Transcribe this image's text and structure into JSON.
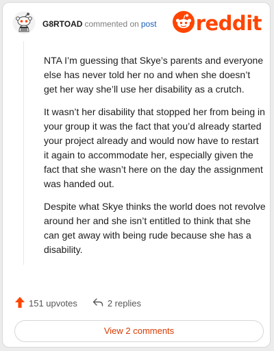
{
  "header": {
    "username": "G8RTOAD",
    "commented_on": "commented on",
    "post_link": "post",
    "logo_text": "reddit"
  },
  "comment": {
    "paragraphs": [
      "NTA I’m guessing that Skye’s parents and everyone else has never told her no and when she doesn’t get her way she’ll use her disability as a crutch.",
      "It wasn’t her disability that stopped her from being in your group it was the fact that you’d already started your project already and would now have to restart it again to accommodate her, especially given the fact that she wasn’t here on the day the assignment was handed out.",
      "Despite what Skye thinks the world does not revolve around her and she isn’t entitled to think that she can get away with being rude because she has a disability."
    ]
  },
  "footer": {
    "upvotes": "151 upvotes",
    "replies": "2 replies",
    "view_button": "View 2 comments"
  },
  "colors": {
    "brand": "#ff4500",
    "link": "#1a5fbd",
    "button_text": "#d93a00"
  },
  "icons": {
    "avatar": "snoo-avatar-icon",
    "logo": "reddit-snoo-icon",
    "upvote": "upvote-arrow-icon",
    "reply": "reply-arrow-icon"
  }
}
